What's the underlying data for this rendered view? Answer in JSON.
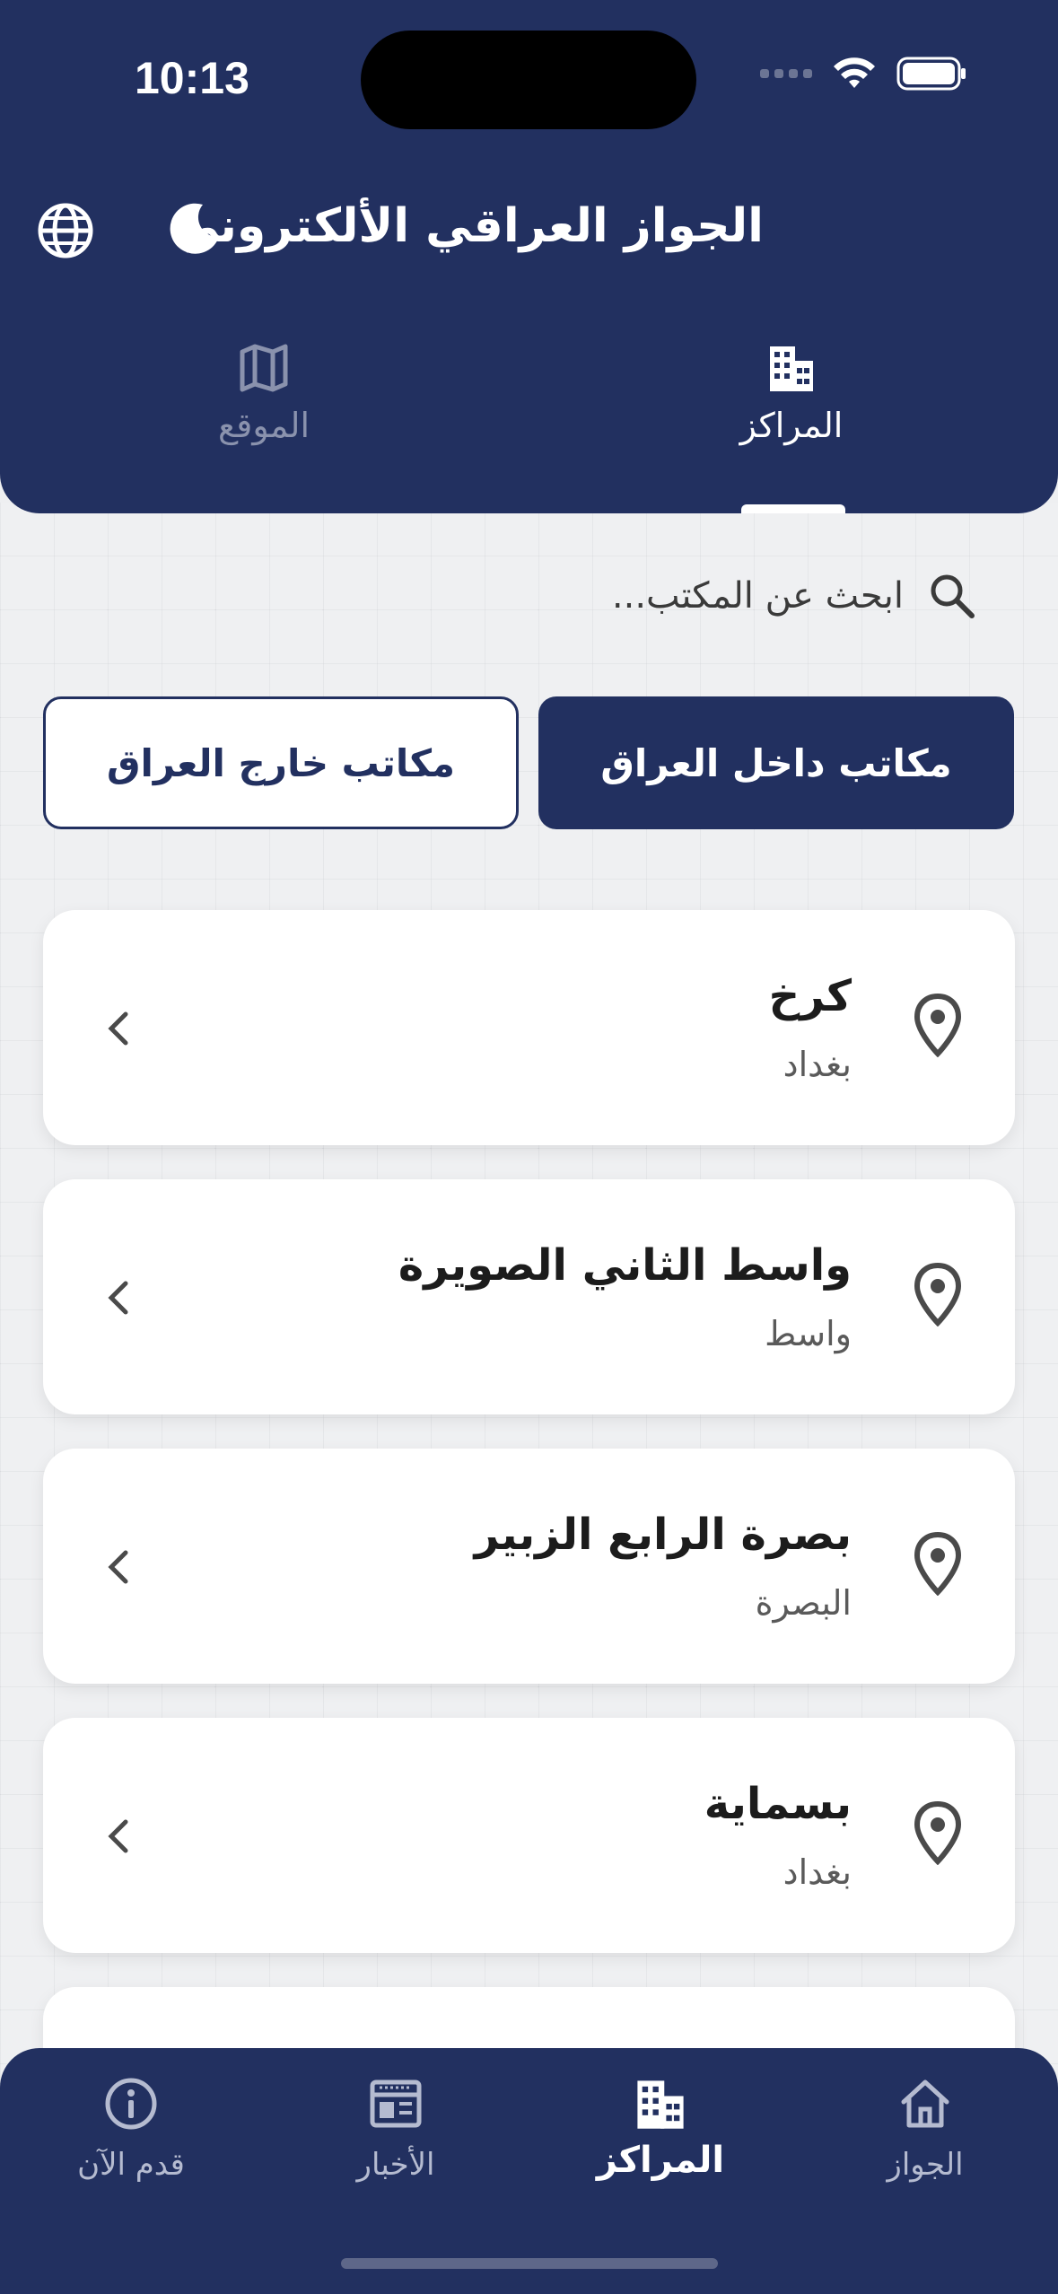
{
  "status_bar": {
    "time": "10:13"
  },
  "header": {
    "title": "الجواز العراقي الألكتروني",
    "icons": [
      "globe-icon",
      "moon-icon"
    ]
  },
  "top_tabs": [
    {
      "label": "المراكز",
      "icon": "buildings-icon",
      "active": true
    },
    {
      "label": "الموقع",
      "icon": "map-icon",
      "active": false
    }
  ],
  "search": {
    "placeholder": "ابحث عن المكتب..."
  },
  "segments": {
    "inside": "مكاتب داخل العراق",
    "outside": "مكاتب خارج العراق",
    "selected": "inside"
  },
  "offices": [
    {
      "name": "كرخ",
      "province": "بغداد"
    },
    {
      "name": "واسط الثاني الصويرة",
      "province": "واسط"
    },
    {
      "name": "بصرة الرابع الزبير",
      "province": "البصرة"
    },
    {
      "name": "بسماية",
      "province": "بغداد"
    }
  ],
  "bottom_nav": [
    {
      "label": "الجواز",
      "icon": "home-icon",
      "active": false
    },
    {
      "label": "المراكز",
      "icon": "buildings-icon",
      "active": true
    },
    {
      "label": "الأخبار",
      "icon": "newspaper-icon",
      "active": false
    },
    {
      "label": "قدم الآن",
      "icon": "info-icon",
      "active": false
    }
  ],
  "colors": {
    "primary": "#223060",
    "background": "#eff0f2",
    "card": "#ffffff"
  }
}
